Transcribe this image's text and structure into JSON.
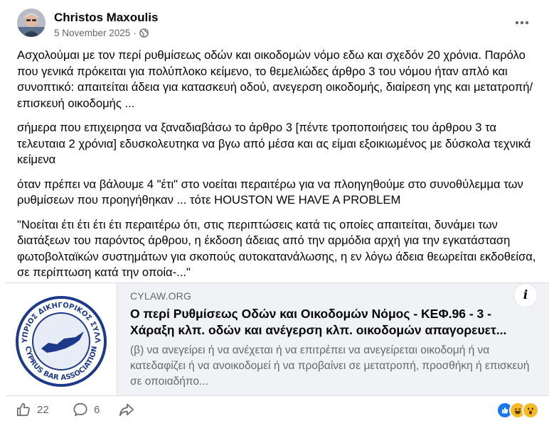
{
  "post": {
    "author": "Christos Maxoulis",
    "date": "5 November 2025",
    "separator": "·",
    "privacy_icon": "globe-icon",
    "paragraphs": [
      "Ασχολούμαι με τον περί ρυθμίσεως οδών και οικοδομών νόμο εδω και σχεδόν 20 χρόνια. Παρόλο που γενικά πρόκειται για πολύπλοκο κείμενο, το θεμελιώδες άρθρο 3 του νόμου ήταν απλό και συνοπτικό: απαιτείται άδεια για κατασκευή οδού, ανεγερση οικοδομής, διαίρεση γης και μετατροπή/ επισκευή οικοδομής ...",
      "σήμερα που επιχειρησα να ξαναδιαβάσω το άρθρο 3 [πέντε τροποποιήσεις του άρθρου 3 τα τελευταια 2 χρόνια] εδυσκολευτηκα να βγω από μέσα και ας είμαι εξοικιωμένος με  δύσκολα τεχνικά κείμενα",
      "όταν πρέπει να βάλουμε 4 \"έτι\" στο νοείται περαιτέρω για να πλοηγηθούμε στο συνοθύλεμμα των ρυθμίσεων που προηγήθηκαν ... τότε HOUSTON WE HAVE A PROBLEM",
      "\"Νοείται έτι έτι έτι έτι περαιτέρω ότι, στις περιπτώσεις κατά τις οποίες απαιτείται, δυνάμει των διατάξεων του παρόντος άρθρου, η έκδοση άδειας από την αρμόδια αρχή για την εγκατάσταση φωτοβολταϊκών συστημάτων για σκοπούς αυτοκατανάλωσης, η εν λόγω άδεια θεωρείται εκδοθείσα, σε περίπτωση κατά την οποία-...\""
    ]
  },
  "link_preview": {
    "domain": "CYLAW.ORG",
    "title": "Ο περί Ρυθμίσεως Οδών και Οικοδομών Νόμος - ΚΕΦ.96 - 3 - Χάραξη κλπ. οδών και ανέγερση κλπ. οικοδομών απαγορευετ...",
    "description": "(β) να ανεγείρει ή να ανέχεται ή να επιτρέπει να ανεγείρεται οικοδομή ή να κατεδαφίζει ή να ανοικοδομεί ή να προβαίνει σε μετατροπή, προσθήκη ή επισκευή σε οποιαδήπο...",
    "info_label": "i",
    "logo_text_top": "ΠΑΓΚΥΠΡΙΟΣ ΔΙΚΗΓΟΡΙΚΟΣ ΣΥΛΛΟΓΟΣ",
    "logo_text_bottom": "CYPRUS BAR ASSOCIATION"
  },
  "footer": {
    "like_count": "22",
    "comment_count": "6",
    "reaction_icons": [
      "like-reaction-icon",
      "haha-reaction-icon",
      "wow-reaction-icon"
    ]
  },
  "colors": {
    "like_blue": "#1877f2",
    "emoji_yellow": "#f7b928",
    "secondary_text": "#65676b"
  }
}
